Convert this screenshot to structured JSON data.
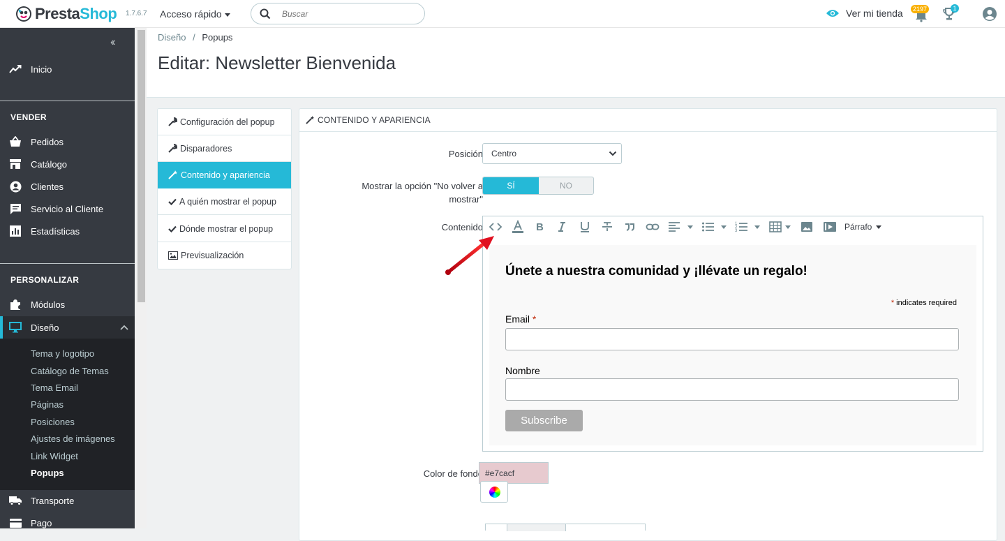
{
  "brand": {
    "name_a": "Presta",
    "name_b": "Shop",
    "version": "1.7.6.7"
  },
  "topbar": {
    "quick_access": "Acceso rápido",
    "search_placeholder": "Buscar",
    "view_shop": "Ver mi tienda",
    "orders_badge": "2197",
    "trophy_badge": "1"
  },
  "sidebar": {
    "home": "Inicio",
    "section_sell": "VENDER",
    "sell_items": [
      "Pedidos",
      "Catálogo",
      "Clientes",
      "Servicio al Cliente",
      "Estadísticas"
    ],
    "section_customize": "PERSONALIZAR",
    "modules": "Módulos",
    "design": "Diseño",
    "design_sub": [
      "Tema y logotipo",
      "Catálogo de Temas",
      "Tema Email",
      "Páginas",
      "Posiciones",
      "Ajustes de imágenes",
      "Link Widget",
      "Popups"
    ],
    "transport": "Transporte",
    "payment": "Pago"
  },
  "breadcrumb": {
    "parent": "Diseño",
    "sep": "/",
    "current": "Popups"
  },
  "page_title": "Editar: Newsletter Bienvenida",
  "tabs": [
    "Configuración del popup",
    "Disparadores",
    "Contenido y apariencia",
    "A quién mostrar el popup",
    "Dónde mostrar el popup",
    "Previsualización"
  ],
  "panel": {
    "title": "CONTENIDO Y APARIENCIA",
    "position_label": "Posición",
    "position_value": "Centro",
    "dont_show_label": "Mostrar la opción \"No volver a mostrar\"",
    "toggle_yes": "SÍ",
    "toggle_no": "NO",
    "content_label": "Contenido",
    "paragraph": "Párrafo",
    "bg_label": "Color de fondo",
    "bg_value": "#e7cacf"
  },
  "editor_content": {
    "title": "Únete a nuestra comunidad y ¡llévate un regalo!",
    "required_star": "*",
    "required_note": "indicates required",
    "email_label": "Email",
    "name_label": "Nombre",
    "subscribe": "Subscribe"
  },
  "colors": {
    "accent": "#25b9d7",
    "sidebar": "#363a41",
    "bg_swatch": "#e7cacf"
  }
}
